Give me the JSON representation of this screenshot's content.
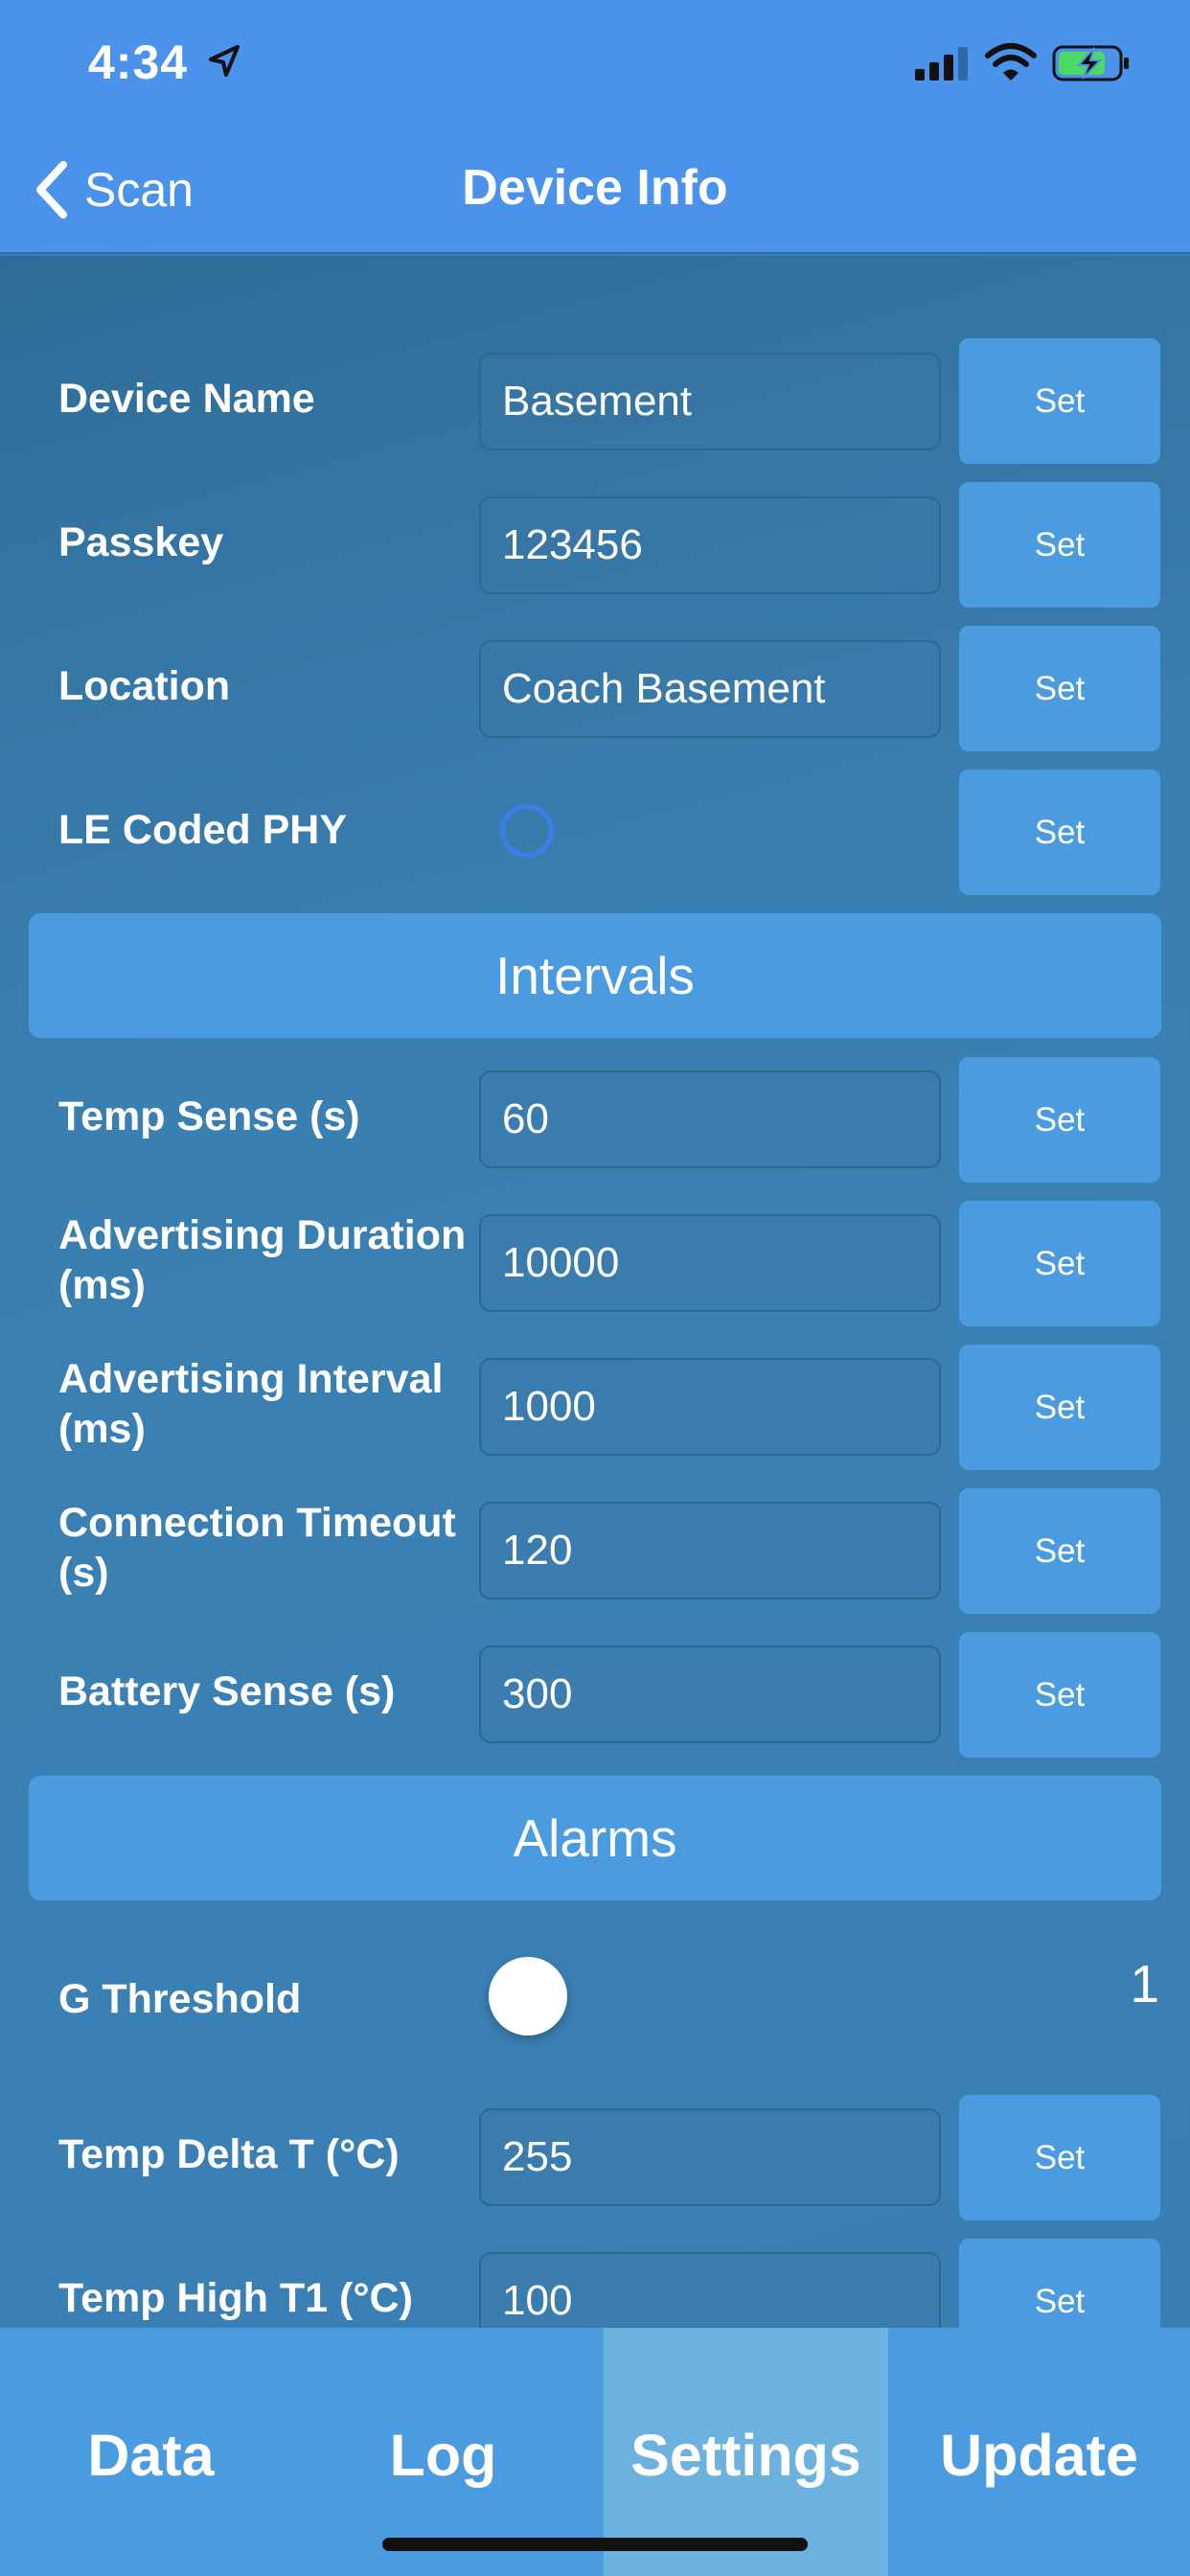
{
  "status_bar": {
    "time": "4:34",
    "icons": [
      "location-arrow-icon",
      "signal-icon",
      "wifi-icon",
      "battery-charging-icon"
    ],
    "battery_color": "#4cd964"
  },
  "nav": {
    "back_label": "Scan",
    "title": "Device Info"
  },
  "colors": {
    "header_bg": "#4a92ea",
    "content_bg": "#3a7fb1",
    "button_bg": "#4a9be0",
    "active_tab_bg": "#6bb2de",
    "radio_ring": "#3a7fe8"
  },
  "device": {
    "device_name": {
      "label": "Device Name",
      "value": "Basement",
      "button": "Set"
    },
    "passkey": {
      "label": "Passkey",
      "value": "123456",
      "button": "Set"
    },
    "location": {
      "label": "Location",
      "value": "Coach Basement",
      "button": "Set"
    },
    "le_coded_phy": {
      "label": "LE Coded PHY",
      "selected": false,
      "button": "Set"
    }
  },
  "intervals": {
    "header": "Intervals",
    "temp_sense": {
      "label": "Temp Sense (s)",
      "value": "60",
      "button": "Set"
    },
    "adv_duration": {
      "label": "Advertising Duration (ms)",
      "value": "10000",
      "button": "Set"
    },
    "adv_interval": {
      "label": "Advertising Interval (ms)",
      "value": "1000",
      "button": "Set"
    },
    "conn_timeout": {
      "label": "Connection Timeout (s)",
      "value": "120",
      "button": "Set"
    },
    "battery_sense": {
      "label": "Battery Sense (s)",
      "value": "300",
      "button": "Set"
    }
  },
  "alarms": {
    "header": "Alarms",
    "g_threshold": {
      "label": "G Threshold",
      "value": "1"
    },
    "temp_delta": {
      "label": "Temp Delta T (°C)",
      "value": "255",
      "button": "Set"
    },
    "temp_high": {
      "label": "Temp High T1 (°C)",
      "value": "100",
      "button": "Set"
    }
  },
  "tabs": [
    {
      "label": "Data",
      "active": false
    },
    {
      "label": "Log",
      "active": false
    },
    {
      "label": "Settings",
      "active": true
    },
    {
      "label": "Update",
      "active": false
    }
  ]
}
